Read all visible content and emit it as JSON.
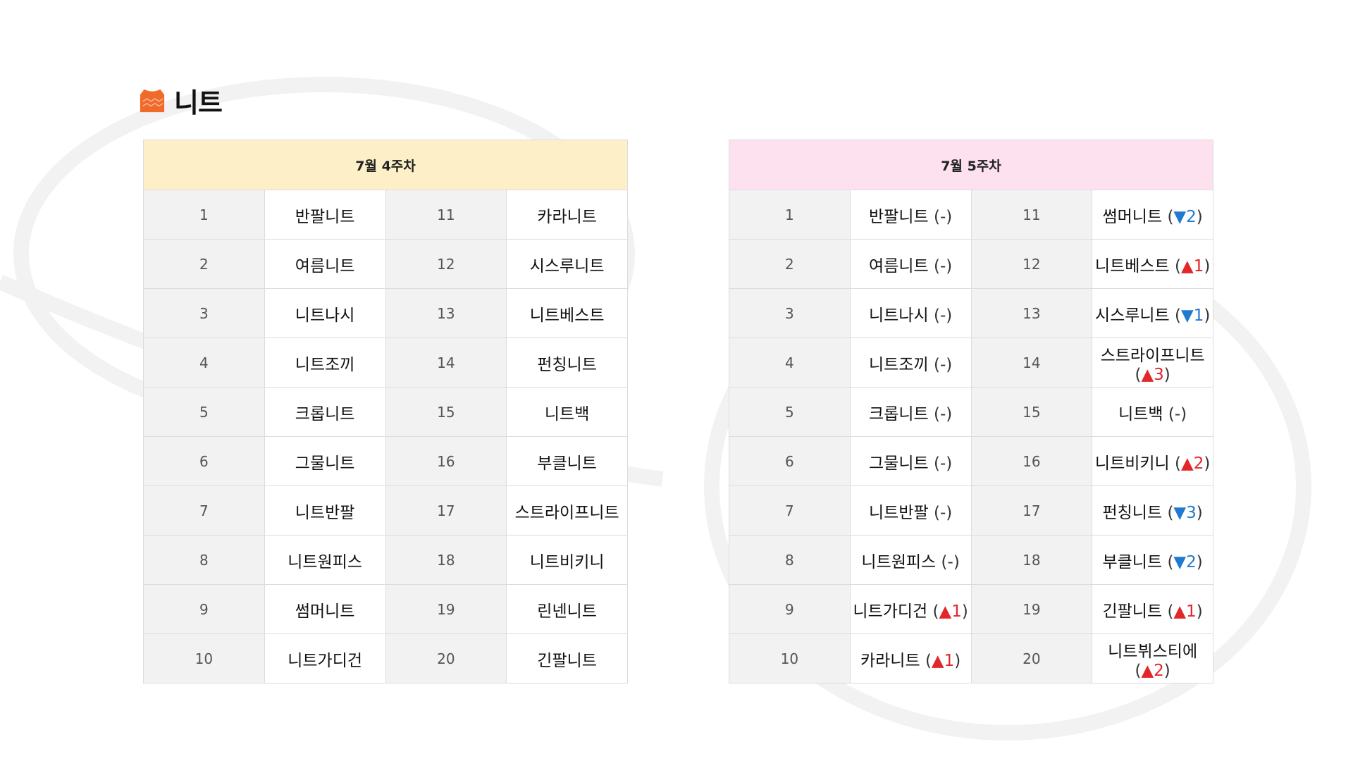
{
  "title": "니트",
  "icon": "sweater-icon",
  "colors": {
    "week4_header_bg": "#fdf0c8",
    "week5_header_bg": "#fde1ef",
    "up": "#e2262a",
    "down": "#1f7bd0",
    "icon": "#f06a2a"
  },
  "week4": {
    "header": "7월 4주차",
    "rows": [
      {
        "rank_a": "1",
        "name_a": "반팔니트",
        "rank_b": "11",
        "name_b": "카라니트"
      },
      {
        "rank_a": "2",
        "name_a": "여름니트",
        "rank_b": "12",
        "name_b": "시스루니트"
      },
      {
        "rank_a": "3",
        "name_a": "니트나시",
        "rank_b": "13",
        "name_b": "니트베스트"
      },
      {
        "rank_a": "4",
        "name_a": "니트조끼",
        "rank_b": "14",
        "name_b": "펀칭니트"
      },
      {
        "rank_a": "5",
        "name_a": "크롭니트",
        "rank_b": "15",
        "name_b": "니트백"
      },
      {
        "rank_a": "6",
        "name_a": "그물니트",
        "rank_b": "16",
        "name_b": "부클니트"
      },
      {
        "rank_a": "7",
        "name_a": "니트반팔",
        "rank_b": "17",
        "name_b": "스트라이프니트"
      },
      {
        "rank_a": "8",
        "name_a": "니트원피스",
        "rank_b": "18",
        "name_b": "니트비키니"
      },
      {
        "rank_a": "9",
        "name_a": "썸머니트",
        "rank_b": "19",
        "name_b": "린넨니트"
      },
      {
        "rank_a": "10",
        "name_a": "니트가디건",
        "rank_b": "20",
        "name_b": "긴팔니트"
      }
    ]
  },
  "week5": {
    "header": "7월 5주차",
    "rows": [
      {
        "rank_a": "1",
        "a": {
          "name": "반팔니트",
          "dir": "same",
          "change": "-"
        },
        "rank_b": "11",
        "b": {
          "name": "썸머니트",
          "dir": "down",
          "change": "2"
        }
      },
      {
        "rank_a": "2",
        "a": {
          "name": "여름니트",
          "dir": "same",
          "change": "-"
        },
        "rank_b": "12",
        "b": {
          "name": "니트베스트",
          "dir": "up",
          "change": "1"
        }
      },
      {
        "rank_a": "3",
        "a": {
          "name": "니트나시",
          "dir": "same",
          "change": "-"
        },
        "rank_b": "13",
        "b": {
          "name": "시스루니트",
          "dir": "down",
          "change": "1"
        }
      },
      {
        "rank_a": "4",
        "a": {
          "name": "니트조끼",
          "dir": "same",
          "change": "-"
        },
        "rank_b": "14",
        "b": {
          "name": "스트라이프니트",
          "dir": "up",
          "change": "3"
        }
      },
      {
        "rank_a": "5",
        "a": {
          "name": "크롭니트",
          "dir": "same",
          "change": "-"
        },
        "rank_b": "15",
        "b": {
          "name": "니트백",
          "dir": "same",
          "change": "-"
        }
      },
      {
        "rank_a": "6",
        "a": {
          "name": "그물니트",
          "dir": "same",
          "change": "-"
        },
        "rank_b": "16",
        "b": {
          "name": "니트비키니",
          "dir": "up",
          "change": "2"
        }
      },
      {
        "rank_a": "7",
        "a": {
          "name": "니트반팔",
          "dir": "same",
          "change": "-"
        },
        "rank_b": "17",
        "b": {
          "name": "펀칭니트",
          "dir": "down",
          "change": "3"
        }
      },
      {
        "rank_a": "8",
        "a": {
          "name": "니트원피스",
          "dir": "same",
          "change": "-"
        },
        "rank_b": "18",
        "b": {
          "name": "부클니트",
          "dir": "down",
          "change": "2"
        }
      },
      {
        "rank_a": "9",
        "a": {
          "name": "니트가디건",
          "dir": "up",
          "change": "1"
        },
        "rank_b": "19",
        "b": {
          "name": "긴팔니트",
          "dir": "up",
          "change": "1"
        }
      },
      {
        "rank_a": "10",
        "a": {
          "name": "카라니트",
          "dir": "up",
          "change": "1"
        },
        "rank_b": "20",
        "b": {
          "name": "니트뷔스티에",
          "dir": "up",
          "change": "2"
        }
      }
    ]
  }
}
